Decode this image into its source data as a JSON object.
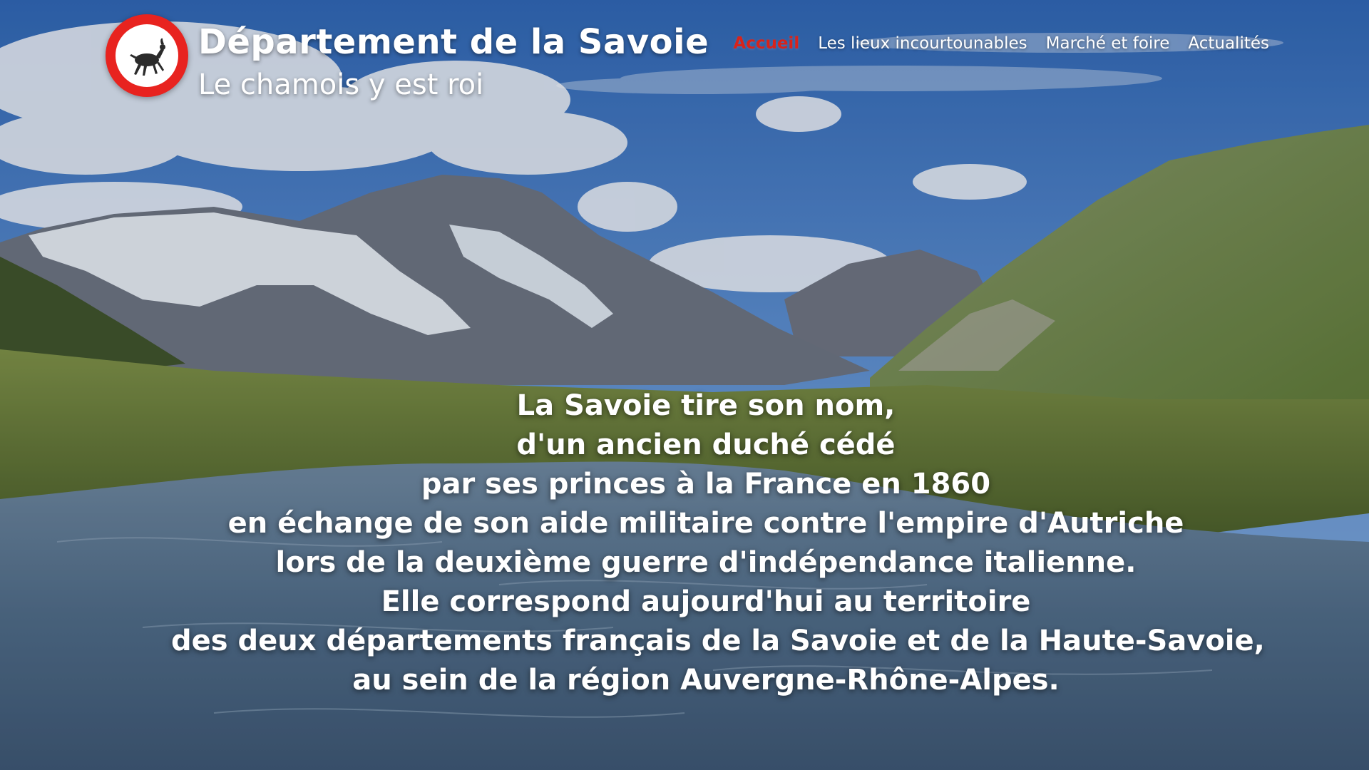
{
  "header": {
    "title": "Département de la Savoie",
    "subtitle": "Le chamois y est roi",
    "logo_icon": "chamois-logo-icon"
  },
  "nav": {
    "items": [
      {
        "label": "Accueil",
        "active": true
      },
      {
        "label": "Les lieux incourtounables",
        "active": false
      },
      {
        "label": "Marché et foire",
        "active": false
      },
      {
        "label": "Actualités",
        "active": false
      }
    ]
  },
  "intro": {
    "lines": [
      "La Savoie tire son nom,",
      "d'un ancien duché cédé",
      "par ses princes à la France en 1860",
      "en échange de son aide militaire contre l'empire d'Autriche",
      "lors de la deuxième guerre d'indépendance italienne.",
      "Elle correspond aujourd'hui au territoire",
      "des deux départements français de la Savoie et de la Haute-Savoie,",
      "au sein de la région Auvergne-Rhône-Alpes."
    ]
  },
  "colors": {
    "accent": "#d8231b",
    "logo_ring": "#e8231f",
    "text": "#ffffff"
  }
}
